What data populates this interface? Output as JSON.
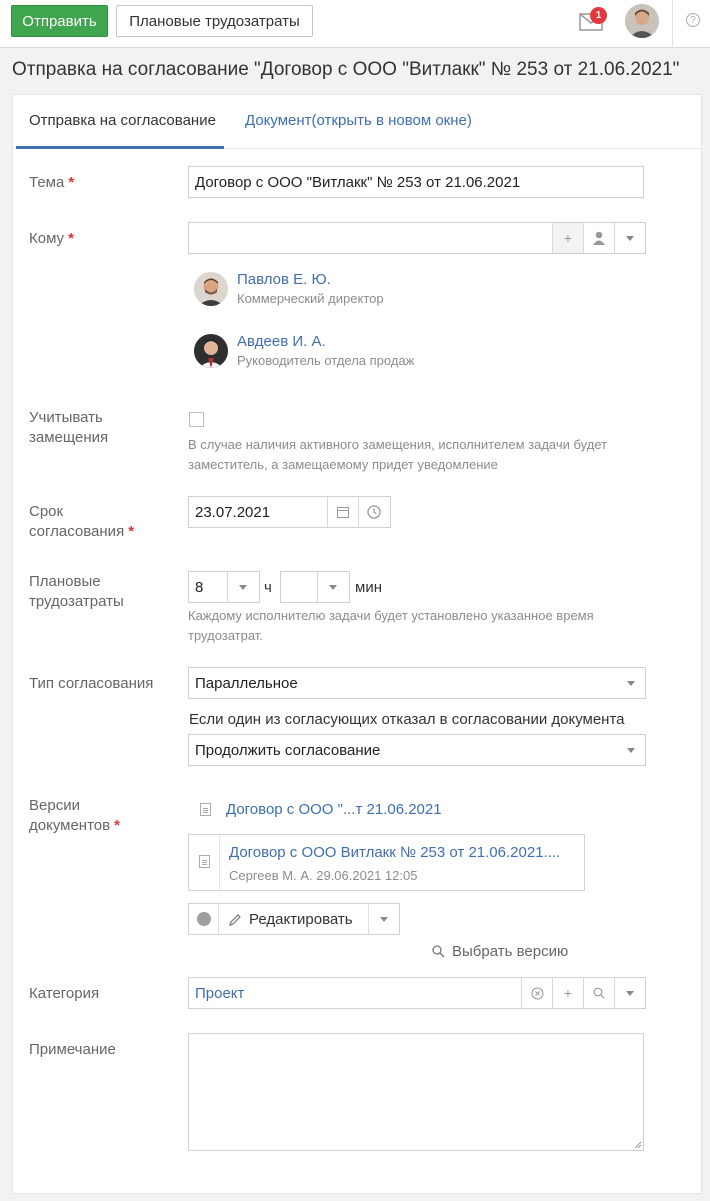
{
  "toolbar": {
    "send_label": "Отправить",
    "planned_effort_label": "Плановые трудозатраты",
    "notifications_count": "1"
  },
  "page": {
    "title": "Отправка на согласование \"Договор с ООО \"Витлакк\" № 253 от 21.06.2021\""
  },
  "tabs": [
    {
      "label": "Отправка на согласование",
      "active": true
    },
    {
      "label": "Документ(открыть в новом окне)",
      "active": false
    }
  ],
  "form": {
    "subject": {
      "label": "Тема",
      "value": "Договор с ООО \"Витлакк\" № 253 от 21.06.2021"
    },
    "to": {
      "label": "Кому",
      "value": "",
      "recipients": [
        {
          "name": "Павлов Е. Ю.",
          "role": "Коммерческий директор"
        },
        {
          "name": "Авдеев И. А.",
          "role": "Руководитель отдела продаж"
        }
      ]
    },
    "substitution": {
      "label_line1": "Учитывать",
      "label_line2": "замещения",
      "checked": false,
      "hint_line1": "В случае наличия активного замещения, исполнителем задачи будет",
      "hint_line2": "заместитель, а замещаемому придет уведомление"
    },
    "deadline": {
      "label_line1": "Срок",
      "label_line2": "согласования",
      "value": "23.07.2021"
    },
    "planned_effort": {
      "label_line1": "Плановые",
      "label_line2": "трудозатраты",
      "hours": "8",
      "hours_unit": "ч",
      "minutes": "",
      "minutes_unit": "мин",
      "hint_line1": "Каждому исполнителю задачи будет установлено указанное время",
      "hint_line2": "трудозатрат."
    },
    "approval_type": {
      "label": "Тип согласования",
      "value": "Параллельное",
      "rejection_label": "Если один из согласующих отказал в согласовании документа",
      "rejection_value": "Продолжить согласование"
    },
    "versions": {
      "label_line1": "Версии",
      "label_line2": "документов",
      "doc_link": "Договор с ООО \"...т 21.06.2021",
      "version_title": "Договор с ООО Витлакк № 253 от 21.06.2021....",
      "version_meta": "Сергеев М. А. 29.06.2021 12:05",
      "edit_label": "Редактировать",
      "choose_version_label": "Выбрать версию"
    },
    "category": {
      "label": "Категория",
      "value": "Проект"
    },
    "note": {
      "label": "Примечание",
      "value": ""
    }
  }
}
